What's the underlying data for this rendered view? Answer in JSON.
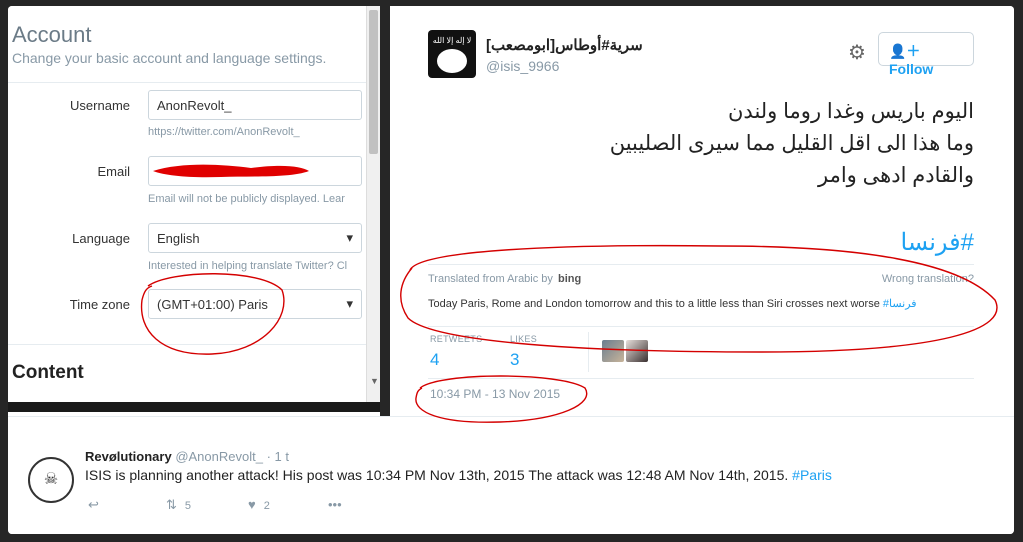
{
  "account": {
    "title": "Account",
    "subtitle": "Change your basic account and language settings.",
    "username_label": "Username",
    "username_value": "AnonRevolt_",
    "username_help": "https://twitter.com/AnonRevolt_",
    "email_label": "Email",
    "email_help": "Email will not be publicly displayed. Lear",
    "language_label": "Language",
    "language_value": "English",
    "language_help": "Interested in helping translate Twitter? Cl",
    "timezone_label": "Time zone",
    "timezone_value": "(GMT+01:00) Paris",
    "content_heading": "Content"
  },
  "tweet": {
    "avatar_text": "لا إله إلا الله",
    "name": "[سرية#أوطاس[ابومصعب",
    "handle": "@isis_9966",
    "follow_label": "Follow",
    "text_lines": [
      "اليوم باريس وغدا روما ولندن",
      "وما هذا الى اقل القليل مما سيرى الصليبين",
      "والقادم ادهى وامر"
    ],
    "hashtag": "#فرنسا",
    "translated_from": "Translated from Arabic by",
    "bing": "bing",
    "wrong_translation": "Wrong translation?",
    "translation": "Today Paris, Rome and London tomorrow and this to a little less than Siri crosses next worse",
    "translation_tag": "#فرنسا",
    "retweets_label": "RETWEETS",
    "retweets_value": "4",
    "likes_label": "LIKES",
    "likes_value": "3",
    "timestamp": "10:34 PM - 13 Nov 2015"
  },
  "reply": {
    "name": "Revølutionary",
    "handle": "@AnonRevolt_",
    "time": "· 1 t",
    "text": "ISIS is planning another attack! His post was 10:34 PM Nov 13th, 2015 The attack was 12:48 AM Nov 14th, 2015.",
    "hashtag": "#Paris",
    "retweet_count": "5",
    "like_count": "2",
    "icons": [
      "reply-icon",
      "retweet-icon",
      "heart-icon",
      "more-icon"
    ]
  },
  "colors": {
    "accent": "#1da1f2",
    "annotation": "#d40000",
    "muted": "#8899a6"
  }
}
